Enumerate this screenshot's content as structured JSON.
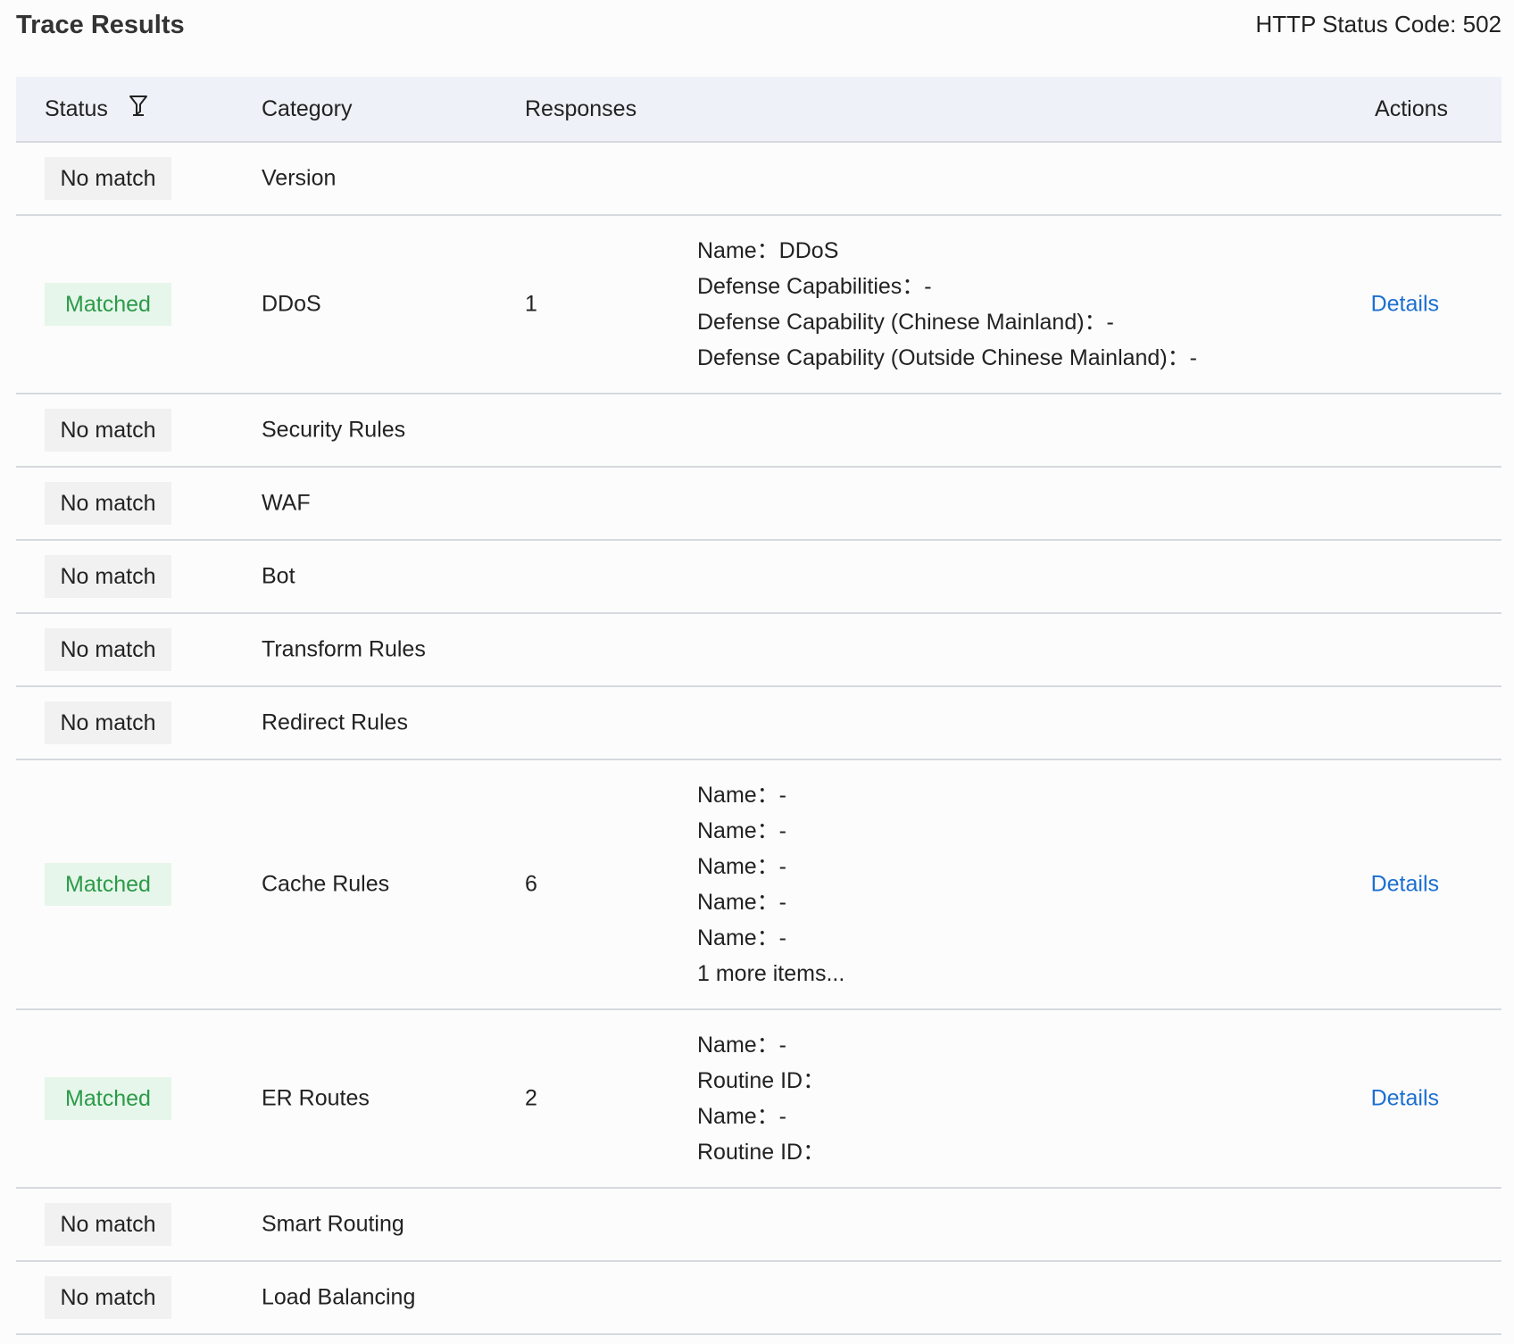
{
  "header": {
    "title": "Trace Results",
    "status_code": "HTTP Status Code: 502"
  },
  "table": {
    "columns": {
      "status": "Status",
      "category": "Category",
      "responses": "Responses",
      "actions": "Actions"
    },
    "rows": [
      {
        "status": "No match",
        "category": "Version",
        "count": "",
        "lines": [],
        "action": ""
      },
      {
        "status": "Matched",
        "category": "DDoS",
        "count": "1",
        "lines": [
          "Name：DDoS",
          "Defense Capabilities：-",
          "Defense Capability (Chinese Mainland)：-",
          "Defense Capability (Outside Chinese Mainland)：-"
        ],
        "action": "Details"
      },
      {
        "status": "No match",
        "category": "Security Rules",
        "count": "",
        "lines": [],
        "action": ""
      },
      {
        "status": "No match",
        "category": "WAF",
        "count": "",
        "lines": [],
        "action": ""
      },
      {
        "status": "No match",
        "category": "Bot",
        "count": "",
        "lines": [],
        "action": ""
      },
      {
        "status": "No match",
        "category": "Transform Rules",
        "count": "",
        "lines": [],
        "action": ""
      },
      {
        "status": "No match",
        "category": "Redirect Rules",
        "count": "",
        "lines": [],
        "action": ""
      },
      {
        "status": "Matched",
        "category": "Cache Rules",
        "count": "6",
        "lines": [
          "Name：-",
          "Name：-",
          "Name：-",
          "Name：-",
          "Name：-",
          "1 more items..."
        ],
        "action": "Details"
      },
      {
        "status": "Matched",
        "category": "ER Routes",
        "count": "2",
        "lines": [
          "Name：-",
          "Routine ID：",
          "Name：-",
          "Routine ID："
        ],
        "action": "Details"
      },
      {
        "status": "No match",
        "category": "Smart Routing",
        "count": "",
        "lines": [],
        "action": ""
      },
      {
        "status": "No match",
        "category": "Load Balancing",
        "count": "",
        "lines": [],
        "action": ""
      }
    ]
  },
  "colors": {
    "matched_text": "#2c9a49",
    "matched_bg": "#e6f6ea",
    "nomatch_bg": "#f1f1f1",
    "link": "#1c6fd1",
    "header_bg": "#eef2f8"
  },
  "icons": {
    "filter": "filter-icon"
  }
}
